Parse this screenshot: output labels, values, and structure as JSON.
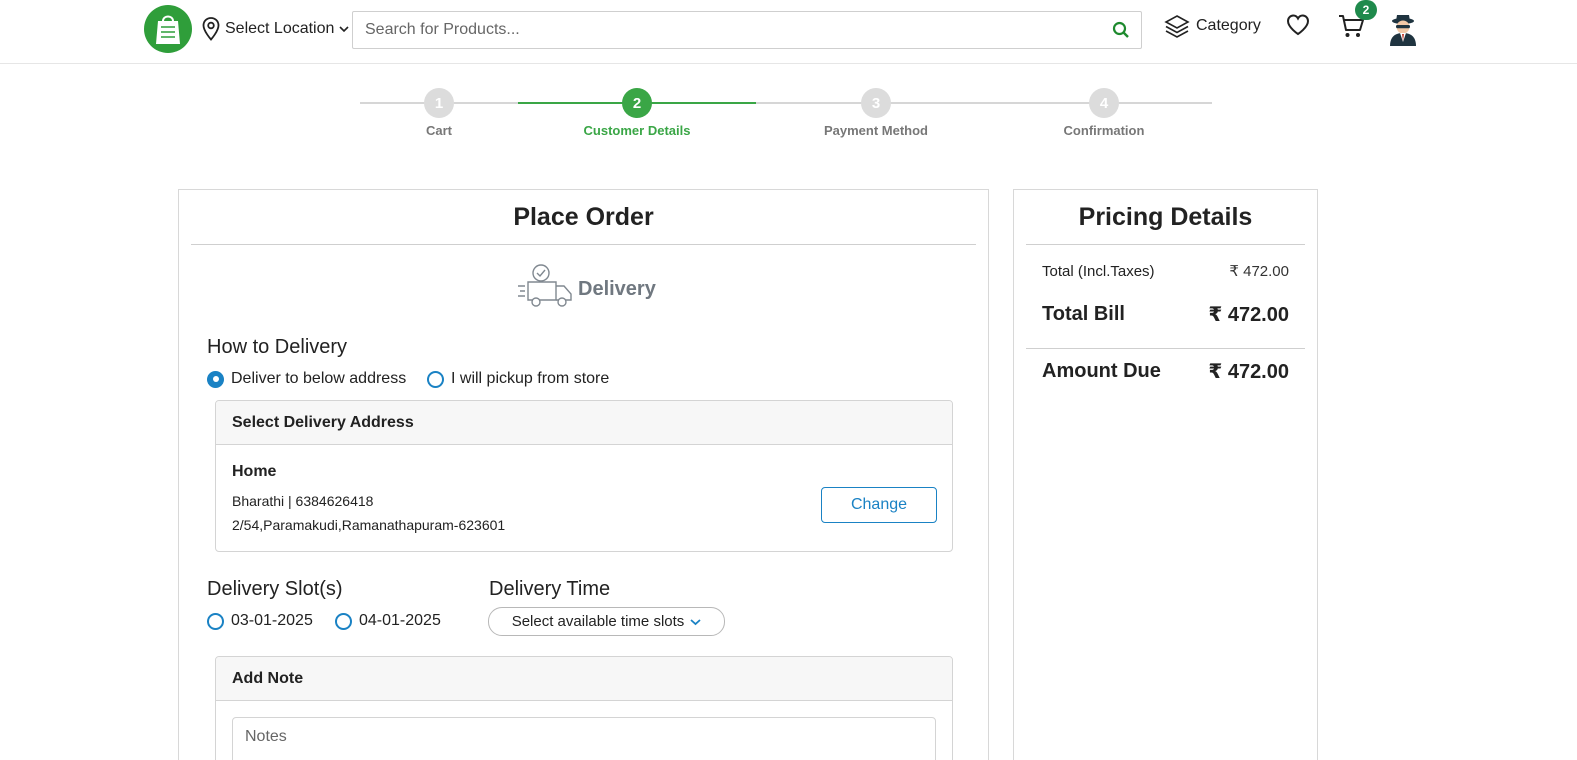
{
  "header": {
    "location_label": "Select Location",
    "search_placeholder": "Search for Products...",
    "category_label": "Category",
    "cart_count": "2"
  },
  "stepper": {
    "steps": [
      {
        "number": "1",
        "label": "Cart",
        "active": false
      },
      {
        "number": "2",
        "label": "Customer Details",
        "active": true
      },
      {
        "number": "3",
        "label": "Payment Method",
        "active": false
      },
      {
        "number": "4",
        "label": "Confirmation",
        "active": false
      }
    ]
  },
  "order": {
    "title": "Place Order",
    "mode_label": "Delivery",
    "how_to_delivery_label": "How to Delivery",
    "options": [
      {
        "label": "Deliver to below address",
        "checked": true
      },
      {
        "label": "I will pickup from store",
        "checked": false
      }
    ],
    "address_card": {
      "title": "Select Delivery Address",
      "name": "Home",
      "contact": "Bharathi | 6384626418",
      "address": "2/54,Paramakudi,Ramanathapuram-623601",
      "change_label": "Change"
    },
    "slots_label": "Delivery Slot(s)",
    "slots": [
      {
        "label": "03-01-2025",
        "checked": false
      },
      {
        "label": "04-01-2025",
        "checked": false
      }
    ],
    "time_label": "Delivery Time",
    "time_select": "Select available time slots",
    "note_card": {
      "title": "Add Note",
      "placeholder": "Notes"
    }
  },
  "pricing": {
    "title": "Pricing Details",
    "total_label": "Total (Incl.Taxes)",
    "total_value": "₹ 472.00",
    "bill_label": "Total Bill",
    "bill_value": "₹ 472.00",
    "due_label": "Amount Due",
    "due_value": "₹ 472.00"
  },
  "colors": {
    "brand_green": "#3aa646",
    "accent_blue": "#1a82c4",
    "badge_green": "#1f8a4c"
  }
}
